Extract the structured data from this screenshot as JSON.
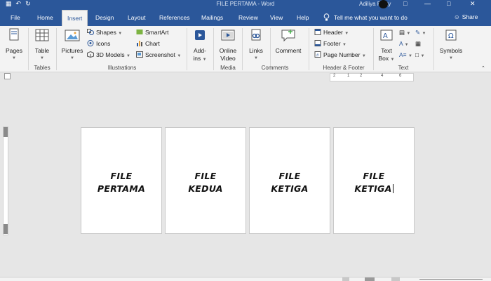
{
  "window": {
    "title": "FILE PERTAMA  -  Word",
    "user": "Adiliya Rizky"
  },
  "tabs": [
    {
      "label": "File"
    },
    {
      "label": "Home"
    },
    {
      "label": "Insert"
    },
    {
      "label": "Design"
    },
    {
      "label": "Layout"
    },
    {
      "label": "References"
    },
    {
      "label": "Mailings"
    },
    {
      "label": "Review"
    },
    {
      "label": "View"
    },
    {
      "label": "Help"
    }
  ],
  "active_tab": "Insert",
  "tell_me": "Tell me what you want to do",
  "share": "Share",
  "ribbon": {
    "pages": {
      "label": "Pages"
    },
    "tables": {
      "table": "Table",
      "group": "Tables"
    },
    "illustrations": {
      "pictures": "Pictures",
      "shapes": "Shapes",
      "icons": "Icons",
      "models": "3D Models",
      "smartart": "SmartArt",
      "chart": "Chart",
      "screenshot": "Screenshot",
      "group": "Illustrations"
    },
    "addins": {
      "label1": "Add-",
      "label2": "ins"
    },
    "media": {
      "online_video1": "Online",
      "online_video2": "Video",
      "group": "Media"
    },
    "comments": {
      "links": "Links",
      "comment": "Comment",
      "group": "Comments"
    },
    "header_footer": {
      "header": "Header",
      "footer": "Footer",
      "page_number": "Page Number",
      "group": "Header & Footer"
    },
    "text": {
      "text_box1": "Text",
      "text_box2": "Box",
      "group": "Text"
    },
    "symbols": {
      "label": "Symbols"
    }
  },
  "ruler": {
    "ticks": [
      "2",
      "1",
      "2",
      "4",
      "6"
    ]
  },
  "pages": [
    {
      "line1": "FILE",
      "line2": "PERTAMA"
    },
    {
      "line1": "FILE",
      "line2": "KEDUA"
    },
    {
      "line1": "FILE",
      "line2": "KETIGA"
    },
    {
      "line1": "FILE",
      "line2": "KETIGA"
    }
  ],
  "colors": {
    "word_blue": "#2b579a",
    "ribbon_bg": "#f3f3f3",
    "canvas_bg": "#e6e6e6"
  }
}
